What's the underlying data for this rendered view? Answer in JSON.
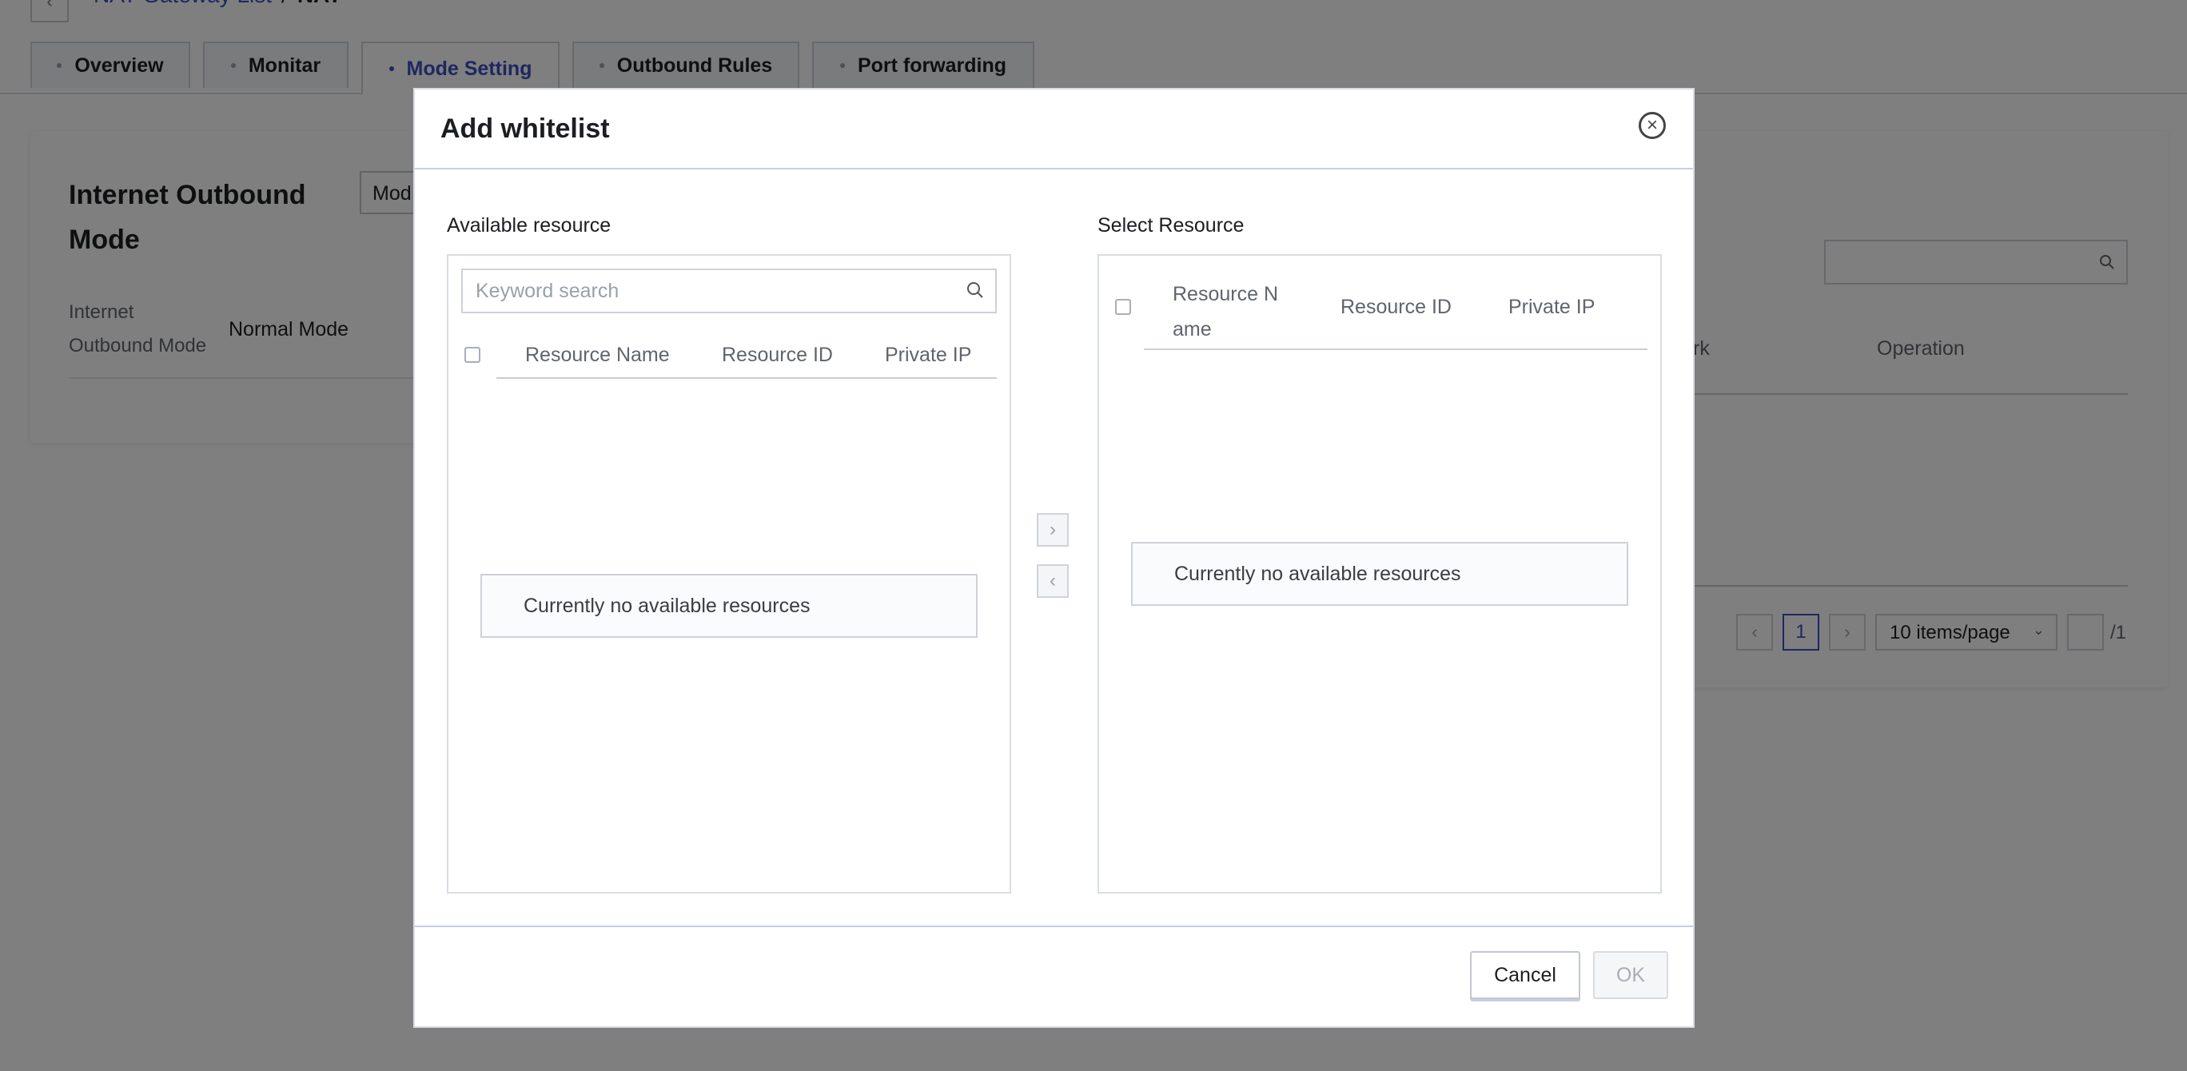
{
  "breadcrumb": {
    "link": "NAT Gateway List",
    "separator": "/",
    "current": "NAT"
  },
  "tabs": [
    "Overview",
    "Monitar",
    "Mode Setting",
    "Outbound Rules",
    "Port forwarding"
  ],
  "left_card": {
    "title_line1": "Internet Outbound",
    "title_line2": "Mode",
    "button_partial": "Mod",
    "field_label_line1": "Internet",
    "field_label_line2": "Outbound Mode",
    "field_value": "Normal Mode"
  },
  "right_card": {
    "col_partial": "rk",
    "col_operation": "Operation",
    "pagination": {
      "prev": "‹",
      "page": "1",
      "next": "›",
      "page_size": "10 items/page",
      "total": "/1"
    }
  },
  "modal": {
    "title": "Add whitelist",
    "close_icon": "×",
    "available": {
      "label": "Available resource",
      "search_placeholder": "Keyword search",
      "columns": [
        "Resource Name",
        "Resource ID",
        "Private IP"
      ],
      "empty_text": "Currently no available resources"
    },
    "selected": {
      "label": "Select Resource",
      "column_name_line1": "Resource N",
      "column_name_line2": "ame",
      "columns": [
        "Resource ID",
        "Private IP"
      ],
      "empty_text": "Currently no available resources"
    },
    "transfer": {
      "right": "›",
      "left": "‹"
    },
    "cancel_label": "Cancel",
    "ok_label": "OK"
  }
}
